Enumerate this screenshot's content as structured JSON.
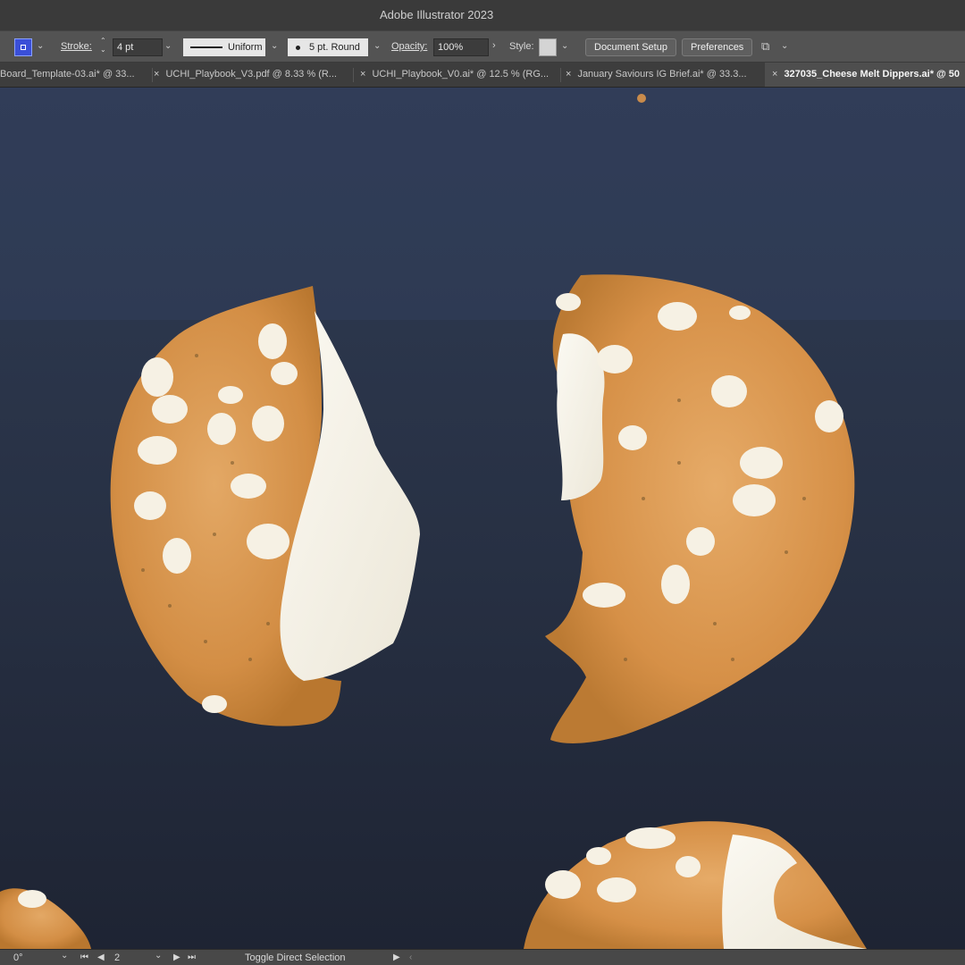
{
  "app": {
    "title": "Adobe Illustrator 2023"
  },
  "control_bar": {
    "stroke_label": "Stroke:",
    "stroke_weight": "4 pt",
    "profile_label": "Uniform",
    "brush_label": "5 pt. Round",
    "opacity_label": "Opacity:",
    "opacity_value": "100%",
    "style_label": "Style:",
    "document_setup": "Document Setup",
    "preferences": "Preferences"
  },
  "tabs": [
    {
      "label": "Board_Template-03.ai* @ 33...",
      "active": false
    },
    {
      "label": "UCHI_Playbook_V3.pdf @ 8.33 % (R...",
      "active": false
    },
    {
      "label": "UCHI_Playbook_V0.ai* @ 12.5 % (RG...",
      "active": false
    },
    {
      "label": "January Saviours IG Brief.ai* @ 33.3...",
      "active": false
    },
    {
      "label": "327035_Cheese Melt Dippers.ai* @ 50",
      "active": true
    }
  ],
  "canvas": {
    "content": "photo-cheese-melt-dippers",
    "colors": {
      "background": "#252d3e",
      "crust": "#d99a52",
      "cheese": "#f7f4ea"
    }
  },
  "status_bar": {
    "rotation": "0°",
    "artboard": "2",
    "tool_hint": "Toggle Direct Selection"
  }
}
